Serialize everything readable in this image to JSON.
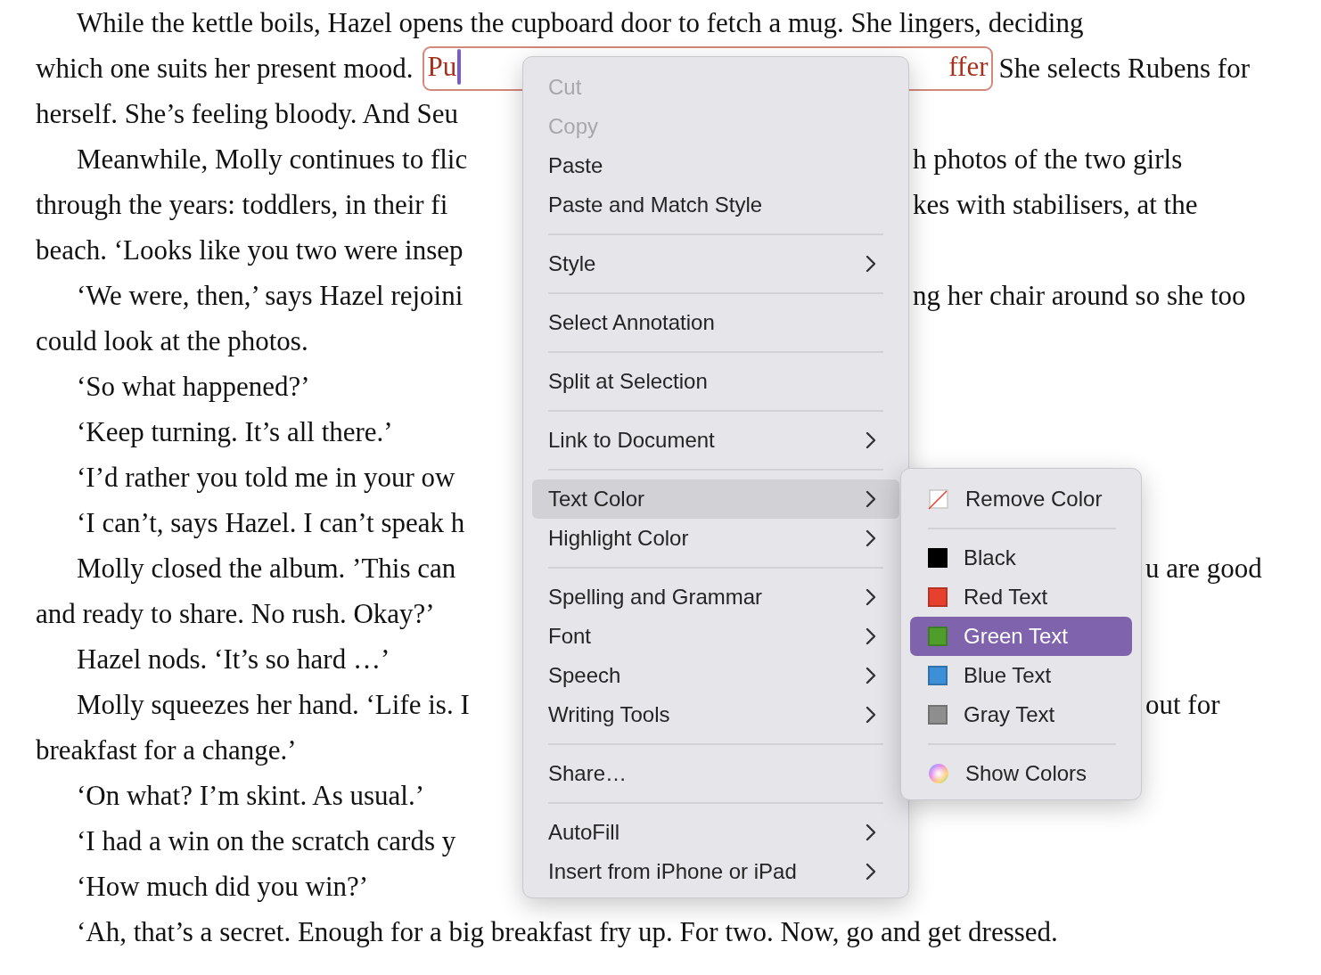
{
  "document": {
    "paragraphs": [
      {
        "lines": [
          {
            "left": "While the kettle boils, Hazel opens the cupboard door to fetch a mug. She lingers, deciding"
          },
          {
            "left": "which one suits her present mood.",
            "annotation": {
              "start": "Pu",
              "end": "ffer"
            },
            "right": "She selects Rubens for"
          },
          {
            "left": "herself. She’s feeling bloody. And Seu"
          }
        ]
      },
      {
        "lines": [
          {
            "left": "Meanwhile, Molly continues to flic",
            "right": "h photos of the two girls"
          },
          {
            "left": "through the years: toddlers, in their fi",
            "right": "kes with stabilisers, at the"
          },
          {
            "left": "beach. ‘Looks like you two were insep"
          }
        ]
      },
      {
        "lines": [
          {
            "left": "‘We were, then,’ says Hazel rejoini",
            "right": "ng her chair around so she too"
          },
          {
            "left": "could look at the photos."
          }
        ]
      },
      {
        "lines": [
          {
            "left": "‘So what happened?’"
          }
        ]
      },
      {
        "lines": [
          {
            "left": "‘Keep turning. It’s all there.’"
          }
        ]
      },
      {
        "lines": [
          {
            "left": "‘I’d rather you told me in your ow"
          }
        ]
      },
      {
        "lines": [
          {
            "left": "‘I can’t, says Hazel. I can’t speak h"
          }
        ]
      },
      {
        "lines": [
          {
            "left": "Molly closed the album. ’This can",
            "right": "u are good"
          },
          {
            "left": "and ready to share. No rush. Okay?’"
          }
        ]
      },
      {
        "lines": [
          {
            "left": "Hazel nods. ‘It’s so hard …’"
          }
        ]
      },
      {
        "lines": [
          {
            "left": "Molly squeezes her hand. ‘Life is. I",
            "right": "out for"
          },
          {
            "left": "breakfast for a change.’"
          }
        ]
      },
      {
        "lines": [
          {
            "left": "‘On what? I’m skint. As usual.’"
          }
        ]
      },
      {
        "lines": [
          {
            "left": "‘I had a win on the scratch cards y"
          }
        ]
      },
      {
        "lines": [
          {
            "left": "‘How much did you win?’"
          }
        ]
      },
      {
        "lines": [
          {
            "left": "‘Ah, that’s a secret. Enough for a big breakfast fry up. For two. Now, go and get dressed."
          }
        ]
      }
    ]
  },
  "context_menu": {
    "items": [
      {
        "kind": "item",
        "label": "Cut",
        "disabled": true,
        "submenu": false,
        "selected": false
      },
      {
        "kind": "item",
        "label": "Copy",
        "disabled": true,
        "submenu": false,
        "selected": false
      },
      {
        "kind": "item",
        "label": "Paste",
        "disabled": false,
        "submenu": false,
        "selected": false
      },
      {
        "kind": "item",
        "label": "Paste and Match Style",
        "disabled": false,
        "submenu": false,
        "selected": false
      },
      {
        "kind": "separator"
      },
      {
        "kind": "item",
        "label": "Style",
        "disabled": false,
        "submenu": true,
        "selected": false
      },
      {
        "kind": "separator"
      },
      {
        "kind": "item",
        "label": "Select Annotation",
        "disabled": false,
        "submenu": false,
        "selected": false
      },
      {
        "kind": "separator"
      },
      {
        "kind": "item",
        "label": "Split at Selection",
        "disabled": false,
        "submenu": false,
        "selected": false
      },
      {
        "kind": "separator"
      },
      {
        "kind": "item",
        "label": "Link to Document",
        "disabled": false,
        "submenu": true,
        "selected": false
      },
      {
        "kind": "separator"
      },
      {
        "kind": "item",
        "label": "Text Color",
        "disabled": false,
        "submenu": true,
        "selected": true
      },
      {
        "kind": "item",
        "label": "Highlight Color",
        "disabled": false,
        "submenu": true,
        "selected": false
      },
      {
        "kind": "separator"
      },
      {
        "kind": "item",
        "label": "Spelling and Grammar",
        "disabled": false,
        "submenu": true,
        "selected": false
      },
      {
        "kind": "item",
        "label": "Font",
        "disabled": false,
        "submenu": true,
        "selected": false
      },
      {
        "kind": "item",
        "label": "Speech",
        "disabled": false,
        "submenu": true,
        "selected": false
      },
      {
        "kind": "item",
        "label": "Writing Tools",
        "disabled": false,
        "submenu": true,
        "selected": false
      },
      {
        "kind": "separator"
      },
      {
        "kind": "item",
        "label": "Share…",
        "disabled": false,
        "submenu": false,
        "selected": false
      },
      {
        "kind": "separator"
      },
      {
        "kind": "item",
        "label": "AutoFill",
        "disabled": false,
        "submenu": true,
        "selected": false
      },
      {
        "kind": "item",
        "label": "Insert from iPhone or iPad",
        "disabled": false,
        "submenu": true,
        "selected": false
      }
    ]
  },
  "color_submenu": {
    "items": [
      {
        "kind": "remove",
        "label": "Remove Color",
        "selected": false
      },
      {
        "kind": "separator"
      },
      {
        "kind": "swatch",
        "label": "Black",
        "color": "#000000",
        "selected": false
      },
      {
        "kind": "swatch",
        "label": "Red Text",
        "color": "#e8402f",
        "selected": false
      },
      {
        "kind": "swatch",
        "label": "Green Text",
        "color": "#4f9e2c",
        "selected": true
      },
      {
        "kind": "swatch",
        "label": "Blue Text",
        "color": "#3d8fd8",
        "selected": false
      },
      {
        "kind": "swatch",
        "label": "Gray Text",
        "color": "#8e8e8e",
        "selected": false
      },
      {
        "kind": "separator"
      },
      {
        "kind": "wheel",
        "label": "Show Colors",
        "selected": false
      }
    ]
  }
}
